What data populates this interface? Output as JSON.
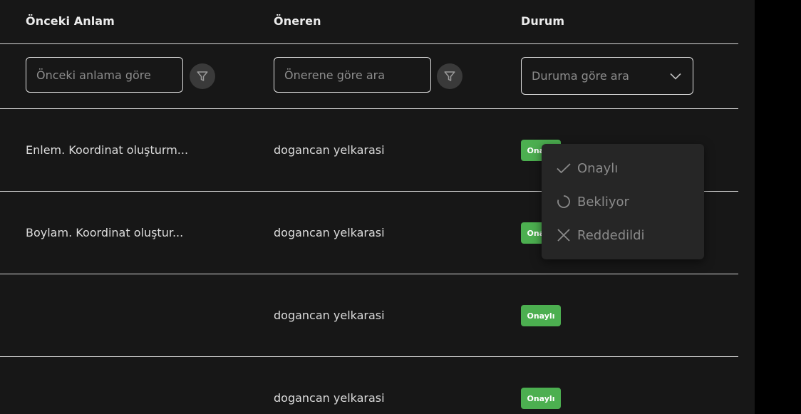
{
  "table": {
    "headers": {
      "previous_meaning": "Önceki Anlam",
      "suggester": "Öneren",
      "status": "Durum"
    },
    "filters": {
      "previous_meaning_placeholder": "Önceki anlama göre",
      "suggester_placeholder": "Önerene göre ara",
      "status_placeholder": "Duruma göre ara"
    },
    "rows": [
      {
        "previous_meaning": "Enlem. Koordinat oluşturm...",
        "suggester": "dogancan yelkarasi",
        "status": "Onaylı"
      },
      {
        "previous_meaning": "Boylam. Koordinat oluştur...",
        "suggester": "dogancan yelkarasi",
        "status": "Onaylı"
      },
      {
        "previous_meaning": "",
        "suggester": "dogancan yelkarasi",
        "status": "Onaylı"
      },
      {
        "previous_meaning": "",
        "suggester": "dogancan yelkarasi",
        "status": "Onaylı"
      }
    ]
  },
  "status_dropdown": {
    "options": [
      {
        "label": "Onaylı",
        "icon": "check-icon"
      },
      {
        "label": "Bekliyor",
        "icon": "pending-circle-icon"
      },
      {
        "label": "Reddedildi",
        "icon": "close-icon"
      }
    ]
  },
  "colors": {
    "background": "#171717",
    "approved_badge": "#4caf50",
    "dropdown_bg": "#262626"
  }
}
